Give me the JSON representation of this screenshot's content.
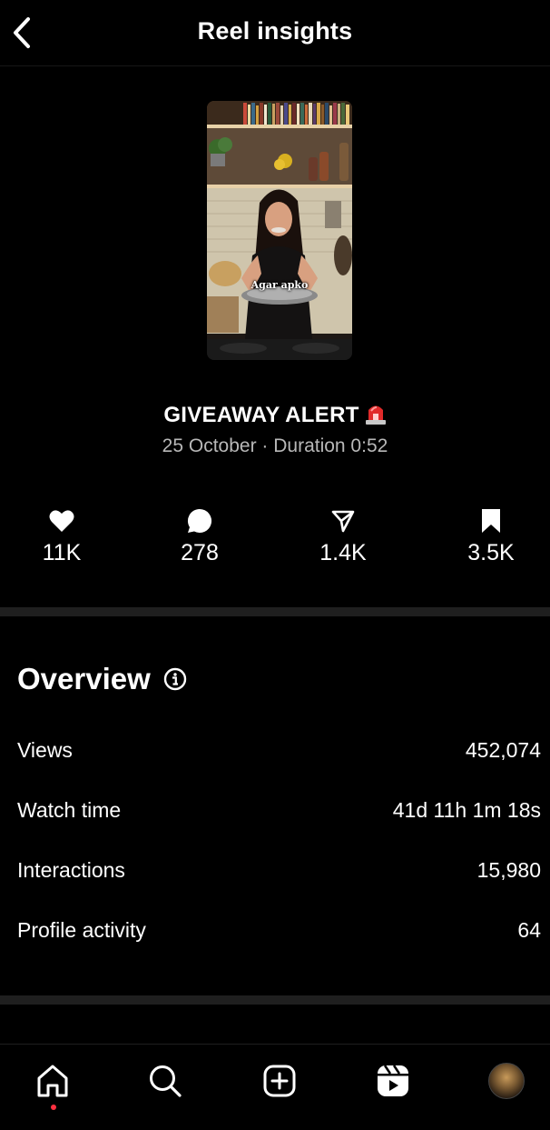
{
  "header": {
    "title": "Reel insights",
    "back_icon": "chevron-left-icon"
  },
  "reel": {
    "caption_overlay": "Agar apko",
    "title": "GIVEAWAY ALERT",
    "title_emoji_icon": "police-siren-icon",
    "subtitle": "25 October · Duration 0:52"
  },
  "stats": [
    {
      "icon": "heart-icon",
      "value": "11K"
    },
    {
      "icon": "comment-icon",
      "value": "278"
    },
    {
      "icon": "share-icon",
      "value": "1.4K"
    },
    {
      "icon": "bookmark-icon",
      "value": "3.5K"
    }
  ],
  "overview": {
    "title": "Overview",
    "info_icon": "info-icon",
    "rows": [
      {
        "label": "Views",
        "value": "452,074"
      },
      {
        "label": "Watch time",
        "value": "41d 11h 1m 18s"
      },
      {
        "label": "Interactions",
        "value": "15,980"
      },
      {
        "label": "Profile activity",
        "value": "64"
      }
    ]
  },
  "tabbar": {
    "items": [
      "home-icon",
      "search-icon",
      "create-icon",
      "reels-icon",
      "profile-avatar"
    ],
    "notification_color": "#ff3040"
  }
}
